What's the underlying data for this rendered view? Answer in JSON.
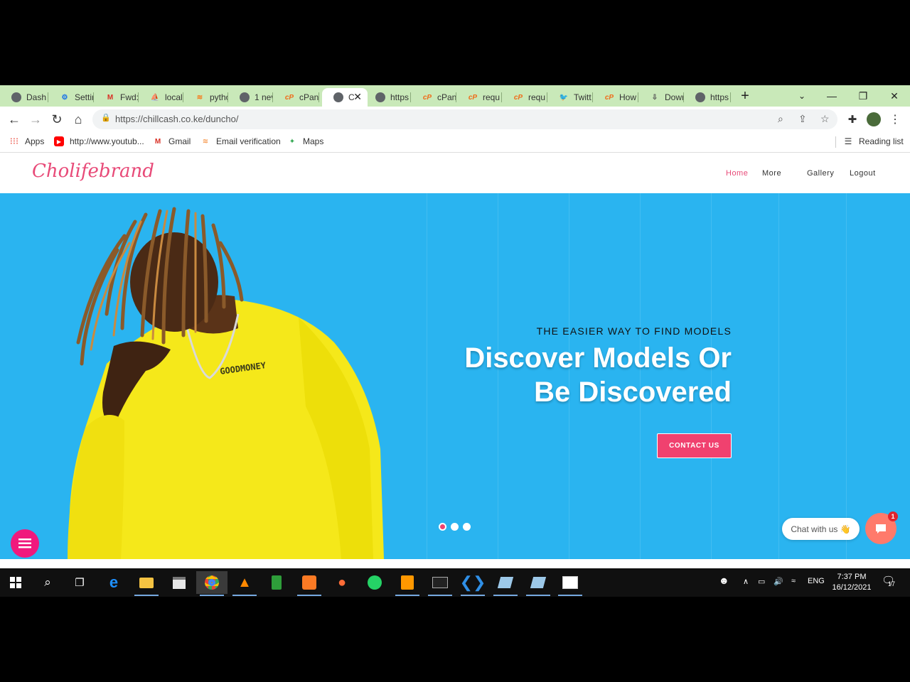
{
  "browser": {
    "tabs": [
      {
        "label": "Dash",
        "icon": "globe-icon"
      },
      {
        "label": "Settir",
        "icon": "gear-icon"
      },
      {
        "label": "Fwd:",
        "icon": "gmail-icon"
      },
      {
        "label": "local",
        "icon": "phpmyadmin-icon"
      },
      {
        "label": "pytho",
        "icon": "stackoverflow-icon"
      },
      {
        "label": "1 nev",
        "icon": "globe-icon"
      },
      {
        "label": "cPane",
        "icon": "cpanel-icon"
      },
      {
        "label": "C",
        "icon": "globe-icon",
        "active": true
      },
      {
        "label": "https",
        "icon": "globe-icon"
      },
      {
        "label": "cPane",
        "icon": "cpanel-icon"
      },
      {
        "label": "requ",
        "icon": "cpanel-icon"
      },
      {
        "label": "requ",
        "icon": "cpanel-icon"
      },
      {
        "label": "Twitt",
        "icon": "twitter-icon"
      },
      {
        "label": "How",
        "icon": "cpanel-icon"
      },
      {
        "label": "Dowr",
        "icon": "download-icon"
      },
      {
        "label": "https",
        "icon": "globe-icon"
      }
    ],
    "url": "https://chillcash.co.ke/duncho/",
    "bookmarks": [
      {
        "label": "Apps",
        "icon": "apps-grid-icon"
      },
      {
        "label": "http://www.youtub...",
        "icon": "youtube-icon"
      },
      {
        "label": "Gmail",
        "icon": "gmail-icon"
      },
      {
        "label": "Email verification",
        "icon": "stackoverflow-icon"
      },
      {
        "label": "Maps",
        "icon": "maps-icon"
      }
    ],
    "reading_list": "Reading list"
  },
  "site": {
    "logo": "Cholifebrand",
    "nav": [
      "Home",
      "More",
      "Gallery",
      "Logout"
    ],
    "hero": {
      "subtitle": "THE EASIER WAY TO FIND MODELS",
      "title_line1": "Discover Models Or",
      "title_line2": "Be Discovered",
      "cta": "CONTACT US",
      "slides": 3,
      "active_slide": 1
    },
    "chat": {
      "label": "Chat with us 👋",
      "badge": "1"
    }
  },
  "taskbar": {
    "language": "ENG",
    "time": "7:37 PM",
    "date": "16/12/2021",
    "notifications": "17"
  },
  "colors": {
    "accent": "#f0416f",
    "hero_bg": "#2ab4f0",
    "tabstrip": "#c9e9b9"
  }
}
